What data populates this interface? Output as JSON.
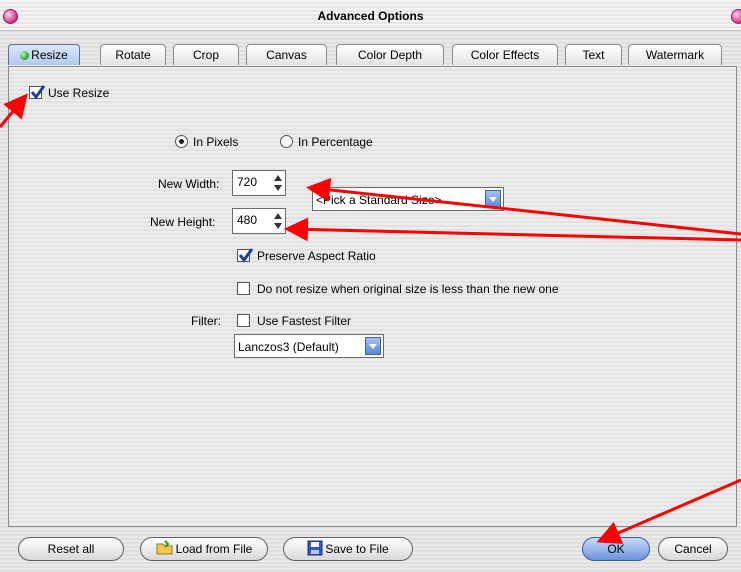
{
  "window": {
    "title": "Advanced Options"
  },
  "tabs": [
    {
      "label": "Resize",
      "active": true
    },
    {
      "label": "Rotate"
    },
    {
      "label": "Crop"
    },
    {
      "label": "Canvas"
    },
    {
      "label": "Color Depth"
    },
    {
      "label": "Color Effects"
    },
    {
      "label": "Text"
    },
    {
      "label": "Watermark"
    }
  ],
  "resize": {
    "use_resize_label": "Use Resize",
    "use_resize_checked": true,
    "mode_pixels_label": "In Pixels",
    "mode_percentage_label": "In Percentage",
    "mode_selected": "In Pixels",
    "width_label": "New Width:",
    "width_value": "720",
    "height_label": "New Height:",
    "height_value": "480",
    "standard_size_value": "<Pick a Standard Size>",
    "preserve_label": "Preserve Aspect Ratio",
    "preserve_checked": true,
    "no_upscale_label": "Do not resize when original size is less than the new one",
    "no_upscale_checked": false,
    "filter_label": "Filter:",
    "fastest_label": "Use Fastest Filter",
    "fastest_checked": false,
    "filter_value": "Lanczos3 (Default)"
  },
  "buttons": {
    "reset": "Reset all",
    "load": "Load from File",
    "save": "Save to File",
    "ok": "OK",
    "cancel": "Cancel"
  },
  "colors": {
    "annotation_arrow": "#ff0000",
    "accent": "#5b87d6",
    "active_led": "#22a020"
  }
}
